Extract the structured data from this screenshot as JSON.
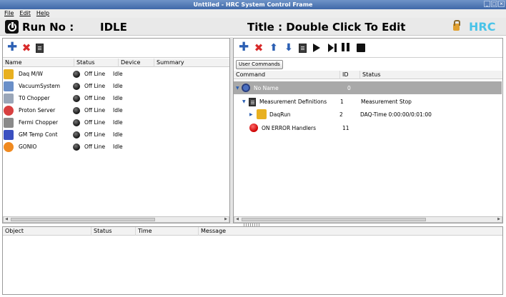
{
  "window": {
    "title": "Unttiled - HRC System Control Frame"
  },
  "menu": {
    "file": "File",
    "edit": "Edit",
    "help": "Help"
  },
  "header": {
    "run_label": "Run No :",
    "run_value": "IDLE",
    "title_label": "Title : Double Click To Edit",
    "brand": "HRC"
  },
  "devices": {
    "columns": [
      "Name",
      "Status",
      "Device",
      "Summary"
    ],
    "rows": [
      {
        "name": "Daq M/W",
        "status": "Off Line",
        "device": "Idle",
        "icon": "daq-icon",
        "color": "#e8b020"
      },
      {
        "name": "VacuumSystem",
        "status": "Off Line",
        "device": "Idle",
        "icon": "vacuum-icon",
        "color": "#6a8fc8"
      },
      {
        "name": "T0 Chopper",
        "status": "Off Line",
        "device": "Idle",
        "icon": "chopper-icon",
        "color": "#9aa6b8"
      },
      {
        "name": "Proton Server",
        "status": "Off Line",
        "device": "Idle",
        "icon": "proton-icon",
        "color": "#d84040"
      },
      {
        "name": "Fermi Chopper",
        "status": "Off Line",
        "device": "Idle",
        "icon": "fermi-icon",
        "color": "#8a8a8a"
      },
      {
        "name": "GM Temp Cont",
        "status": "Off Line",
        "device": "Idle",
        "icon": "temp-icon",
        "color": "#3a4fc0"
      },
      {
        "name": "GONIO",
        "status": "Off Line",
        "device": "Idle",
        "icon": "gonio-icon",
        "color": "#f08a20"
      }
    ]
  },
  "commands": {
    "user_commands_button": "User Commands",
    "columns": [
      "Command",
      "ID",
      "Status"
    ],
    "rows": [
      {
        "label": "No Name",
        "id": "0",
        "status": "",
        "selected": true
      },
      {
        "label": "Measurement Definitions",
        "id": "1",
        "status": "Measurement Stop"
      },
      {
        "label": "DaqRun",
        "id": "2",
        "status": "DAQ-Time 0:00:00/0:01:00"
      },
      {
        "label": "ON ERROR Handlers",
        "id": "11",
        "status": ""
      }
    ]
  },
  "log": {
    "columns": [
      "Object",
      "Status",
      "Time",
      "Message"
    ]
  },
  "colors": {
    "brand": "#49c3e8",
    "selection": "#a9a9a9",
    "titlebar": "#4f77b6"
  }
}
